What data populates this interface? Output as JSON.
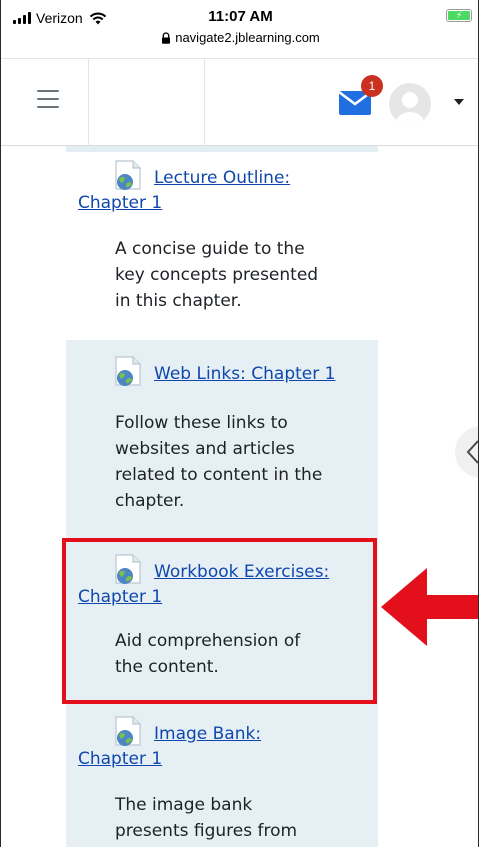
{
  "status_bar": {
    "carrier": "Verizon",
    "time": "11:07 AM",
    "url": "navigate2.jblearning.com"
  },
  "navbar": {
    "messages_badge": "1"
  },
  "activities": [
    {
      "link_first": "Lecture Outline:",
      "link_second": "Chapter 1",
      "desc_lines": [
        "A concise guide to the",
        "key concepts presented",
        "in this chapter."
      ]
    },
    {
      "link_first": "Web Links: Chapter 1",
      "link_second": "",
      "desc_lines": [
        "Follow these links to",
        "websites and articles",
        "related to content in the",
        "chapter."
      ]
    },
    {
      "link_first": "Workbook Exercises:",
      "link_second": "Chapter 1",
      "desc_lines": [
        "Aid comprehension of",
        "the content."
      ]
    },
    {
      "link_first": "Image Bank:",
      "link_second": "Chapter 1",
      "desc_lines": [
        "The image bank",
        "presents figures from"
      ]
    }
  ],
  "colors": {
    "link": "#0f47ad",
    "shaded_bg": "#e6f0f4",
    "highlight": "#e3101c",
    "badge": "#ca3120",
    "mail_icon": "#1f6fe0"
  },
  "icons": {
    "activity": "url-globe-icon",
    "menu": "hamburger-menu-icon",
    "messages": "envelope-icon",
    "drawer": "chevron-left-icon"
  }
}
